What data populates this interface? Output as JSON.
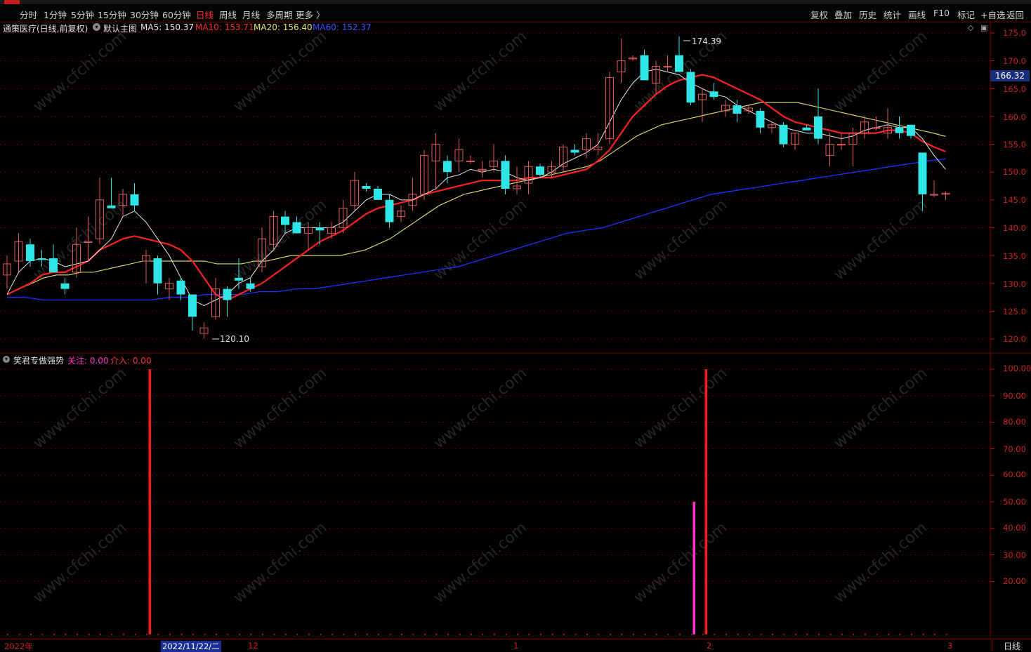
{
  "toolbar": {
    "left": [
      "分时",
      "1分钟",
      "5分钟",
      "15分钟",
      "30分钟",
      "60分钟",
      "日线",
      "周线",
      "月线",
      "多周期",
      "更多 〉"
    ],
    "active": "日线",
    "right": [
      "复权",
      "叠加",
      "历史",
      "统计",
      "画线",
      "F10",
      "标记",
      "+自选",
      "返回"
    ]
  },
  "legend": {
    "stock": "通策医疗(日线,前复权)",
    "main_icon": "circle-down-icon",
    "main_label": "默认主图",
    "ma5": "MA5: 150.37",
    "ma10": "MA10: 153.71",
    "ma20": "MA20: 156.40",
    "ma60": "MA60: 152.37"
  },
  "indicator_legend": {
    "name": "笑君专做强势",
    "guanzhu": "关注: 0.00",
    "jieru": "介入: 0.00"
  },
  "annotations": {
    "high": "174.39",
    "low": "120.10",
    "last_price": "166.32"
  },
  "colors": {
    "up": "#e05a5a",
    "down": "#2ee6e6",
    "ma5": "#e8e8e8",
    "ma10": "#ff2020",
    "ma20": "#e6e66a",
    "ma60": "#2030ff",
    "axis": "#d02020",
    "indicator_red": "#ff1a1a",
    "indicator_magenta": "#ff33cc"
  },
  "price_axis": [
    "175.0",
    "170.0",
    "165.0",
    "160.0",
    "155.0",
    "150.0",
    "145.0",
    "140.0",
    "135.0",
    "130.0",
    "125.0",
    "120.0"
  ],
  "indicator_axis": [
    "100.00",
    "90.00",
    "80.00",
    "70.00",
    "60.00",
    "50.00",
    "40.00",
    "30.00",
    "20.00"
  ],
  "date_axis": [
    "2022年",
    "2022/11/22/二",
    "12",
    "1",
    "2",
    "3"
  ],
  "period_button": "日线",
  "watermark": "www.cfchi.com",
  "chart_data": {
    "type": "candlestick",
    "title": "通策医疗(日线,前复权)",
    "ylim": [
      120,
      175
    ],
    "candles": [
      {
        "o": 131.5,
        "h": 135,
        "l": 129,
        "c": 133.5
      },
      {
        "o": 134,
        "h": 139,
        "l": 132,
        "c": 137.5
      },
      {
        "o": 137,
        "h": 138,
        "l": 133,
        "c": 134
      },
      {
        "o": 134.5,
        "h": 136,
        "l": 133,
        "c": 134.2
      },
      {
        "o": 134.5,
        "h": 137,
        "l": 132,
        "c": 132
      },
      {
        "o": 130,
        "h": 131,
        "l": 128,
        "c": 129
      },
      {
        "o": 132,
        "h": 140,
        "l": 131,
        "c": 137
      },
      {
        "o": 137.5,
        "h": 142,
        "l": 134,
        "c": 137.5
      },
      {
        "o": 138,
        "h": 149,
        "l": 137,
        "c": 145
      },
      {
        "o": 144,
        "h": 149,
        "l": 143.5,
        "c": 143.5
      },
      {
        "o": 144,
        "h": 147,
        "l": 142,
        "c": 146
      },
      {
        "o": 146,
        "h": 148,
        "l": 143,
        "c": 144
      },
      {
        "o": 134,
        "h": 136,
        "l": 130,
        "c": 135
      },
      {
        "o": 134.5,
        "h": 135,
        "l": 128,
        "c": 130
      },
      {
        "o": 129,
        "h": 131,
        "l": 127,
        "c": 130
      },
      {
        "o": 130.5,
        "h": 131,
        "l": 127,
        "c": 128
      },
      {
        "o": 128,
        "h": 128,
        "l": 121.5,
        "c": 124
      },
      {
        "o": 121,
        "h": 123,
        "l": 120.1,
        "c": 122
      },
      {
        "o": 124,
        "h": 131,
        "l": 123.5,
        "c": 129
      },
      {
        "o": 129,
        "h": 129.5,
        "l": 124,
        "c": 127
      },
      {
        "o": 131,
        "h": 134.5,
        "l": 129,
        "c": 130.5
      },
      {
        "o": 130,
        "h": 131,
        "l": 128.5,
        "c": 129
      },
      {
        "o": 133,
        "h": 140,
        "l": 132,
        "c": 138
      },
      {
        "o": 137,
        "h": 143,
        "l": 136,
        "c": 142
      },
      {
        "o": 142,
        "h": 143,
        "l": 139,
        "c": 140.5
      },
      {
        "o": 141,
        "h": 142,
        "l": 139,
        "c": 139
      },
      {
        "o": 139,
        "h": 141,
        "l": 136,
        "c": 140
      },
      {
        "o": 140,
        "h": 141,
        "l": 137,
        "c": 139.5
      },
      {
        "o": 139,
        "h": 141,
        "l": 138,
        "c": 140
      },
      {
        "o": 140,
        "h": 145,
        "l": 139,
        "c": 143.5
      },
      {
        "o": 144,
        "h": 150,
        "l": 143,
        "c": 148.5
      },
      {
        "o": 147.5,
        "h": 148,
        "l": 146.5,
        "c": 147
      },
      {
        "o": 147,
        "h": 147.5,
        "l": 145,
        "c": 145
      },
      {
        "o": 145,
        "h": 146,
        "l": 140,
        "c": 141
      },
      {
        "o": 142,
        "h": 144,
        "l": 141,
        "c": 143
      },
      {
        "o": 144,
        "h": 149,
        "l": 143,
        "c": 146
      },
      {
        "o": 146,
        "h": 154,
        "l": 145,
        "c": 153
      },
      {
        "o": 152,
        "h": 157,
        "l": 147,
        "c": 155
      },
      {
        "o": 152,
        "h": 153,
        "l": 148,
        "c": 150
      },
      {
        "o": 152,
        "h": 156,
        "l": 150,
        "c": 154
      },
      {
        "o": 152,
        "h": 153,
        "l": 151.5,
        "c": 152
      },
      {
        "o": 150.5,
        "h": 152,
        "l": 149,
        "c": 150.5
      },
      {
        "o": 151,
        "h": 155,
        "l": 150,
        "c": 152
      },
      {
        "o": 152,
        "h": 153,
        "l": 146,
        "c": 147
      },
      {
        "o": 147,
        "h": 151,
        "l": 146,
        "c": 147.5
      },
      {
        "o": 148,
        "h": 152,
        "l": 146,
        "c": 151
      },
      {
        "o": 151,
        "h": 151.5,
        "l": 149,
        "c": 149.5
      },
      {
        "o": 150,
        "h": 152,
        "l": 149,
        "c": 151
      },
      {
        "o": 151,
        "h": 155,
        "l": 150,
        "c": 154.5
      },
      {
        "o": 154,
        "h": 155,
        "l": 153,
        "c": 153.5
      },
      {
        "o": 154,
        "h": 157,
        "l": 152.5,
        "c": 156
      },
      {
        "o": 154,
        "h": 157,
        "l": 153,
        "c": 154.5
      },
      {
        "o": 156,
        "h": 168,
        "l": 155,
        "c": 167
      },
      {
        "o": 168,
        "h": 174,
        "l": 166,
        "c": 170
      },
      {
        "o": 170.5,
        "h": 171,
        "l": 170,
        "c": 170.5
      },
      {
        "o": 171,
        "h": 172,
        "l": 167,
        "c": 166.5
      },
      {
        "o": 166,
        "h": 170,
        "l": 164,
        "c": 169
      },
      {
        "o": 169,
        "h": 171,
        "l": 168,
        "c": 169
      },
      {
        "o": 171,
        "h": 174.4,
        "l": 168.5,
        "c": 168
      },
      {
        "o": 168,
        "h": 168.5,
        "l": 162,
        "c": 162.5
      },
      {
        "o": 163,
        "h": 165,
        "l": 159,
        "c": 164
      },
      {
        "o": 164.5,
        "h": 166,
        "l": 163,
        "c": 163.5
      },
      {
        "o": 161,
        "h": 163,
        "l": 160,
        "c": 162
      },
      {
        "o": 162,
        "h": 163,
        "l": 159,
        "c": 160.5
      },
      {
        "o": 161,
        "h": 162,
        "l": 160.5,
        "c": 161.5
      },
      {
        "o": 161,
        "h": 161.5,
        "l": 157,
        "c": 158
      },
      {
        "o": 158,
        "h": 159,
        "l": 157,
        "c": 158.5
      },
      {
        "o": 158.5,
        "h": 159,
        "l": 154.5,
        "c": 155
      },
      {
        "o": 155,
        "h": 157,
        "l": 154,
        "c": 157
      },
      {
        "o": 158,
        "h": 158.5,
        "l": 157.5,
        "c": 157.5
      },
      {
        "o": 160,
        "h": 165,
        "l": 155,
        "c": 156
      },
      {
        "o": 153,
        "h": 157,
        "l": 151,
        "c": 155
      },
      {
        "o": 155,
        "h": 157,
        "l": 154,
        "c": 155
      },
      {
        "o": 155,
        "h": 158,
        "l": 151,
        "c": 157
      },
      {
        "o": 157,
        "h": 160,
        "l": 156,
        "c": 159
      },
      {
        "o": 158,
        "h": 160,
        "l": 157.5,
        "c": 158
      },
      {
        "o": 157,
        "h": 161.5,
        "l": 156,
        "c": 158
      },
      {
        "o": 158,
        "h": 160,
        "l": 156,
        "c": 157
      },
      {
        "o": 158.5,
        "h": 158,
        "l": 156,
        "c": 156.5
      },
      {
        "o": 153.5,
        "h": 153,
        "l": 143,
        "c": 146
      },
      {
        "o": 146,
        "h": 148.5,
        "l": 145.5,
        "c": 146
      },
      {
        "o": 146,
        "h": 146.5,
        "l": 145,
        "c": 146.2
      }
    ],
    "ma5": [
      128,
      132,
      134,
      134.5,
      134,
      133,
      133.5,
      134,
      136,
      138,
      142,
      143,
      141,
      138,
      135,
      131,
      127,
      126,
      127,
      128,
      130,
      131,
      134,
      136,
      139,
      140,
      140,
      140,
      140,
      141,
      143,
      145,
      146,
      146,
      145,
      145,
      146,
      147,
      149,
      149.5,
      150.5,
      150,
      150.5,
      150,
      149,
      148.5,
      149,
      150,
      151.5,
      152.5,
      153.5,
      155,
      159,
      163,
      166,
      168,
      168.5,
      168,
      167.5,
      166,
      165,
      164,
      163.5,
      162,
      161,
      160,
      159,
      158,
      157.5,
      157,
      157,
      156.5,
      156,
      156.5,
      157.5,
      158,
      158.5,
      158,
      158,
      156,
      153,
      150.5
    ],
    "ma10": [
      128,
      129,
      130,
      131.5,
      132,
      132,
      133,
      134,
      136,
      137,
      138,
      138.5,
      138,
      137.5,
      137,
      136,
      134,
      131,
      128,
      127,
      128,
      129,
      130,
      131.5,
      133,
      134.5,
      136,
      137.5,
      138.5,
      139.5,
      141,
      142.5,
      143.5,
      144,
      144.5,
      145,
      146,
      146.5,
      147,
      147.5,
      148,
      148.5,
      148.5,
      148.5,
      148.5,
      149,
      149,
      149,
      149.5,
      150,
      150.5,
      152,
      154,
      157,
      160,
      162,
      164,
      165.5,
      166.5,
      167,
      167.5,
      167,
      166,
      165,
      164,
      163,
      161.5,
      160,
      159,
      158.5,
      158,
      157.5,
      157,
      157,
      157,
      157,
      157.5,
      157.5,
      157,
      155.5,
      154.5,
      153.7
    ],
    "ma20": [
      128,
      129,
      130,
      131,
      131.5,
      131.5,
      132,
      132,
      132.5,
      133,
      133.5,
      134,
      134,
      134,
      134,
      134,
      134,
      133.5,
      133.5,
      133.5,
      134,
      134,
      134.5,
      135,
      135,
      135,
      135,
      135,
      135.5,
      136,
      137,
      138,
      139.5,
      141,
      142.5,
      144,
      145,
      146,
      146.5,
      147,
      147.5,
      148,
      148.5,
      149,
      149.5,
      150,
      150.5,
      151,
      152,
      153.5,
      155,
      156.5,
      157.5,
      158.5,
      159,
      159.5,
      160,
      160.5,
      161,
      161.5,
      162,
      162.5,
      162.5,
      162.5,
      162.5,
      162,
      161.5,
      161,
      160.5,
      160,
      159.5,
      159,
      158.5,
      158,
      157.5,
      157,
      156.4
    ],
    "ma60": [
      127.5,
      127.5,
      127,
      127,
      127,
      127,
      127,
      127,
      127,
      127.5,
      127.5,
      128,
      128,
      128,
      128.5,
      128.5,
      129,
      129,
      129.5,
      130,
      130.5,
      131,
      131.5,
      132,
      132.5,
      133,
      134,
      135,
      136,
      137,
      138,
      139,
      139.5,
      140,
      141,
      142,
      143,
      144,
      145,
      146,
      146.5,
      147,
      147.5,
      148,
      148.5,
      149,
      149.5,
      150,
      150.5,
      151,
      151.5,
      152,
      152.37
    ],
    "indicator_bars": [
      {
        "index": 12,
        "value": 100,
        "color": "red"
      },
      {
        "index": 59,
        "value": 50,
        "color": "magenta"
      },
      {
        "index": 60,
        "value": 100,
        "color": "red"
      }
    ]
  }
}
